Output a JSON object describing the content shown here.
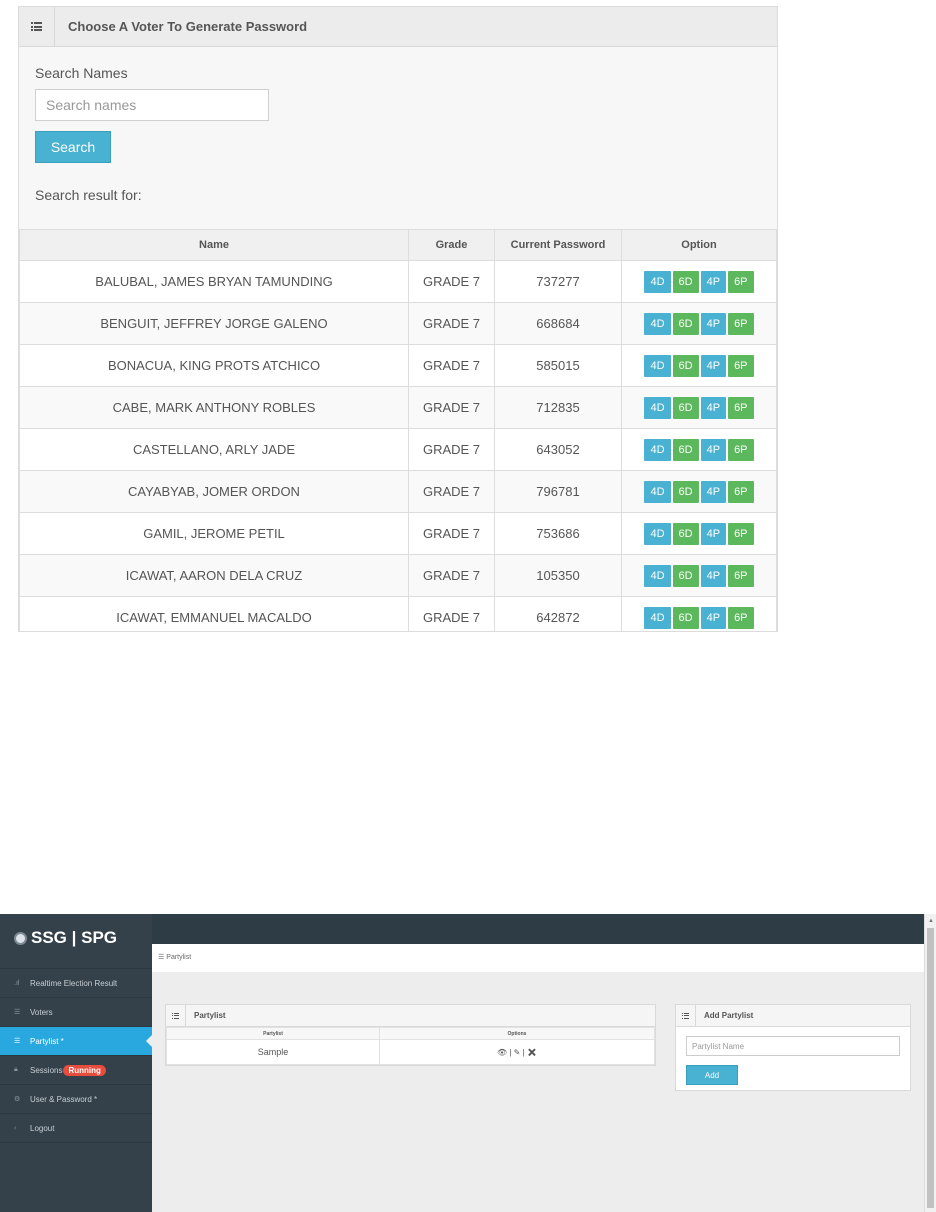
{
  "voter_panel": {
    "title": "Choose A Voter To Generate Password",
    "search_label": "Search Names",
    "search_placeholder": "Search names",
    "search_button": "Search",
    "result_label": "Search result for:",
    "columns": [
      "Name",
      "Grade",
      "Current Password",
      "Option"
    ],
    "option_buttons": [
      "4D",
      "6D",
      "4P",
      "6P"
    ],
    "rows": [
      {
        "name": "BALUBAL, JAMES BRYAN TAMUNDING",
        "grade": "GRADE 7",
        "password": "737277"
      },
      {
        "name": "BENGUIT, JEFFREY JORGE GALENO",
        "grade": "GRADE 7",
        "password": "668684"
      },
      {
        "name": "BONACUA, KING PROTS ATCHICO",
        "grade": "GRADE 7",
        "password": "585015"
      },
      {
        "name": "CABE, MARK ANTHONY ROBLES",
        "grade": "GRADE 7",
        "password": "712835"
      },
      {
        "name": "CASTELLANO, ARLY JADE",
        "grade": "GRADE 7",
        "password": "643052"
      },
      {
        "name": "CAYABYAB, JOMER ORDON",
        "grade": "GRADE 7",
        "password": "796781"
      },
      {
        "name": "GAMIL, JEROME PETIL",
        "grade": "GRADE 7",
        "password": "753686"
      },
      {
        "name": "ICAWAT, AARON DELA CRUZ",
        "grade": "GRADE 7",
        "password": "105350"
      },
      {
        "name": "ICAWAT, EMMANUEL MACALDO",
        "grade": "GRADE 7",
        "password": "642872"
      }
    ]
  },
  "admin": {
    "logo": "SSG | SPG",
    "breadcrumb": "Partylist",
    "sidebar": [
      {
        "label": "Realtime Election Result",
        "icon": "bar-chart-icon",
        "glyph": ".ıl"
      },
      {
        "label": "Voters",
        "icon": "list-icon",
        "glyph": "☰"
      },
      {
        "label": "Partylist *",
        "icon": "list-icon",
        "glyph": "☰"
      },
      {
        "label": "Sessions",
        "icon": "lock-icon",
        "glyph": "🔒︎",
        "badge": "Running"
      },
      {
        "label": "User & Password *",
        "icon": "gear-icon",
        "glyph": "⚙"
      },
      {
        "label": "Logout",
        "icon": "chevron-left-icon",
        "glyph": "‹"
      }
    ],
    "partylist_box": {
      "title": "Partylist",
      "columns": [
        "Partylist",
        "Options"
      ],
      "rows": [
        {
          "name": "Sample",
          "options": "👁 | ✎ | ✖"
        }
      ]
    },
    "add_box": {
      "title": "Add Partylist",
      "placeholder": "Partylist Name",
      "button": "Add"
    }
  }
}
